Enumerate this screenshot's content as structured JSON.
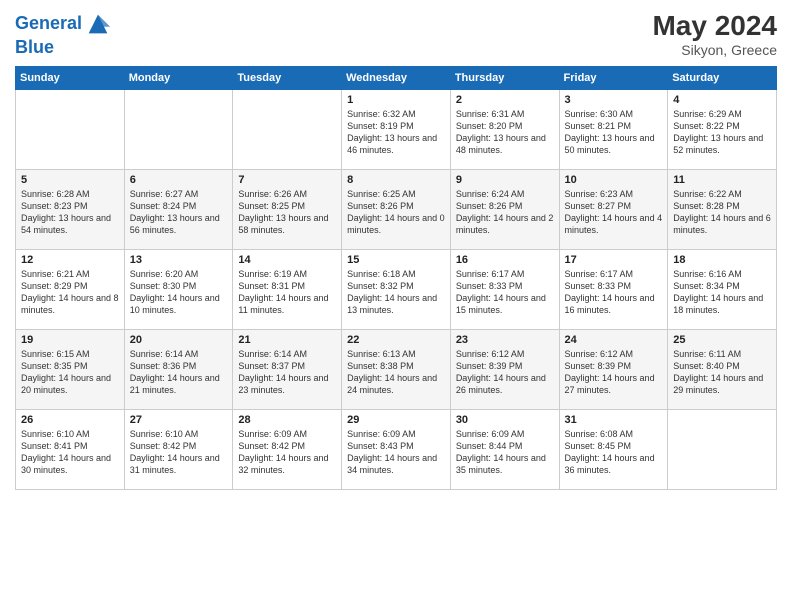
{
  "logo": {
    "line1": "General",
    "line2": "Blue"
  },
  "title": {
    "month_year": "May 2024",
    "location": "Sikyon, Greece"
  },
  "weekdays": [
    "Sunday",
    "Monday",
    "Tuesday",
    "Wednesday",
    "Thursday",
    "Friday",
    "Saturday"
  ],
  "weeks": [
    [
      {
        "day": "",
        "info": ""
      },
      {
        "day": "",
        "info": ""
      },
      {
        "day": "",
        "info": ""
      },
      {
        "day": "1",
        "info": "Sunrise: 6:32 AM\nSunset: 8:19 PM\nDaylight: 13 hours and 46 minutes."
      },
      {
        "day": "2",
        "info": "Sunrise: 6:31 AM\nSunset: 8:20 PM\nDaylight: 13 hours and 48 minutes."
      },
      {
        "day": "3",
        "info": "Sunrise: 6:30 AM\nSunset: 8:21 PM\nDaylight: 13 hours and 50 minutes."
      },
      {
        "day": "4",
        "info": "Sunrise: 6:29 AM\nSunset: 8:22 PM\nDaylight: 13 hours and 52 minutes."
      }
    ],
    [
      {
        "day": "5",
        "info": "Sunrise: 6:28 AM\nSunset: 8:23 PM\nDaylight: 13 hours and 54 minutes."
      },
      {
        "day": "6",
        "info": "Sunrise: 6:27 AM\nSunset: 8:24 PM\nDaylight: 13 hours and 56 minutes."
      },
      {
        "day": "7",
        "info": "Sunrise: 6:26 AM\nSunset: 8:25 PM\nDaylight: 13 hours and 58 minutes."
      },
      {
        "day": "8",
        "info": "Sunrise: 6:25 AM\nSunset: 8:26 PM\nDaylight: 14 hours and 0 minutes."
      },
      {
        "day": "9",
        "info": "Sunrise: 6:24 AM\nSunset: 8:26 PM\nDaylight: 14 hours and 2 minutes."
      },
      {
        "day": "10",
        "info": "Sunrise: 6:23 AM\nSunset: 8:27 PM\nDaylight: 14 hours and 4 minutes."
      },
      {
        "day": "11",
        "info": "Sunrise: 6:22 AM\nSunset: 8:28 PM\nDaylight: 14 hours and 6 minutes."
      }
    ],
    [
      {
        "day": "12",
        "info": "Sunrise: 6:21 AM\nSunset: 8:29 PM\nDaylight: 14 hours and 8 minutes."
      },
      {
        "day": "13",
        "info": "Sunrise: 6:20 AM\nSunset: 8:30 PM\nDaylight: 14 hours and 10 minutes."
      },
      {
        "day": "14",
        "info": "Sunrise: 6:19 AM\nSunset: 8:31 PM\nDaylight: 14 hours and 11 minutes."
      },
      {
        "day": "15",
        "info": "Sunrise: 6:18 AM\nSunset: 8:32 PM\nDaylight: 14 hours and 13 minutes."
      },
      {
        "day": "16",
        "info": "Sunrise: 6:17 AM\nSunset: 8:33 PM\nDaylight: 14 hours and 15 minutes."
      },
      {
        "day": "17",
        "info": "Sunrise: 6:17 AM\nSunset: 8:33 PM\nDaylight: 14 hours and 16 minutes."
      },
      {
        "day": "18",
        "info": "Sunrise: 6:16 AM\nSunset: 8:34 PM\nDaylight: 14 hours and 18 minutes."
      }
    ],
    [
      {
        "day": "19",
        "info": "Sunrise: 6:15 AM\nSunset: 8:35 PM\nDaylight: 14 hours and 20 minutes."
      },
      {
        "day": "20",
        "info": "Sunrise: 6:14 AM\nSunset: 8:36 PM\nDaylight: 14 hours and 21 minutes."
      },
      {
        "day": "21",
        "info": "Sunrise: 6:14 AM\nSunset: 8:37 PM\nDaylight: 14 hours and 23 minutes."
      },
      {
        "day": "22",
        "info": "Sunrise: 6:13 AM\nSunset: 8:38 PM\nDaylight: 14 hours and 24 minutes."
      },
      {
        "day": "23",
        "info": "Sunrise: 6:12 AM\nSunset: 8:39 PM\nDaylight: 14 hours and 26 minutes."
      },
      {
        "day": "24",
        "info": "Sunrise: 6:12 AM\nSunset: 8:39 PM\nDaylight: 14 hours and 27 minutes."
      },
      {
        "day": "25",
        "info": "Sunrise: 6:11 AM\nSunset: 8:40 PM\nDaylight: 14 hours and 29 minutes."
      }
    ],
    [
      {
        "day": "26",
        "info": "Sunrise: 6:10 AM\nSunset: 8:41 PM\nDaylight: 14 hours and 30 minutes."
      },
      {
        "day": "27",
        "info": "Sunrise: 6:10 AM\nSunset: 8:42 PM\nDaylight: 14 hours and 31 minutes."
      },
      {
        "day": "28",
        "info": "Sunrise: 6:09 AM\nSunset: 8:42 PM\nDaylight: 14 hours and 32 minutes."
      },
      {
        "day": "29",
        "info": "Sunrise: 6:09 AM\nSunset: 8:43 PM\nDaylight: 14 hours and 34 minutes."
      },
      {
        "day": "30",
        "info": "Sunrise: 6:09 AM\nSunset: 8:44 PM\nDaylight: 14 hours and 35 minutes."
      },
      {
        "day": "31",
        "info": "Sunrise: 6:08 AM\nSunset: 8:45 PM\nDaylight: 14 hours and 36 minutes."
      },
      {
        "day": "",
        "info": ""
      }
    ]
  ]
}
